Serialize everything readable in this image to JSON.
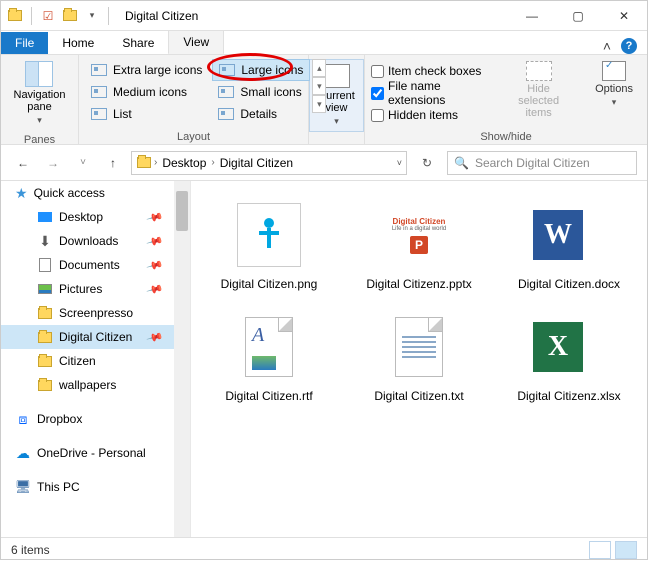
{
  "title": "Digital Citizen",
  "tabs": {
    "file": "File",
    "home": "Home",
    "share": "Share",
    "view": "View"
  },
  "ribbon": {
    "panes": {
      "label": "Panes",
      "nav": "Navigation\npane"
    },
    "layout": {
      "label": "Layout",
      "opts": [
        "Extra large icons",
        "Large icons",
        "Medium icons",
        "Small icons",
        "List",
        "Details"
      ]
    },
    "curview": "Current\nview",
    "showhide": {
      "label": "Show/hide",
      "c1": "Item check boxes",
      "c2": "File name extensions",
      "c3": "Hidden items",
      "hide": "Hide selected\nitems",
      "options": "Options"
    }
  },
  "breadcrumb": {
    "p1": "Desktop",
    "p2": "Digital Citizen"
  },
  "search_placeholder": "Search Digital Citizen",
  "sidebar": {
    "quick": "Quick access",
    "items": [
      "Desktop",
      "Downloads",
      "Documents",
      "Pictures",
      "Screenpresso",
      "Digital Citizen",
      "Citizen",
      "wallpapers"
    ],
    "dropbox": "Dropbox",
    "onedrive": "OneDrive - Personal",
    "thispc": "This PC"
  },
  "files": [
    {
      "name": "Digital Citizen.png"
    },
    {
      "name": "Digital Citizenz.pptx"
    },
    {
      "name": "Digital Citizen.docx"
    },
    {
      "name": "Digital Citizen.rtf"
    },
    {
      "name": "Digital Citizen.txt"
    },
    {
      "name": "Digital Citizenz.xlsx"
    }
  ],
  "status": "6 items",
  "pptx_text1": "Digital Citizen",
  "pptx_text2": "Life in a digital world"
}
